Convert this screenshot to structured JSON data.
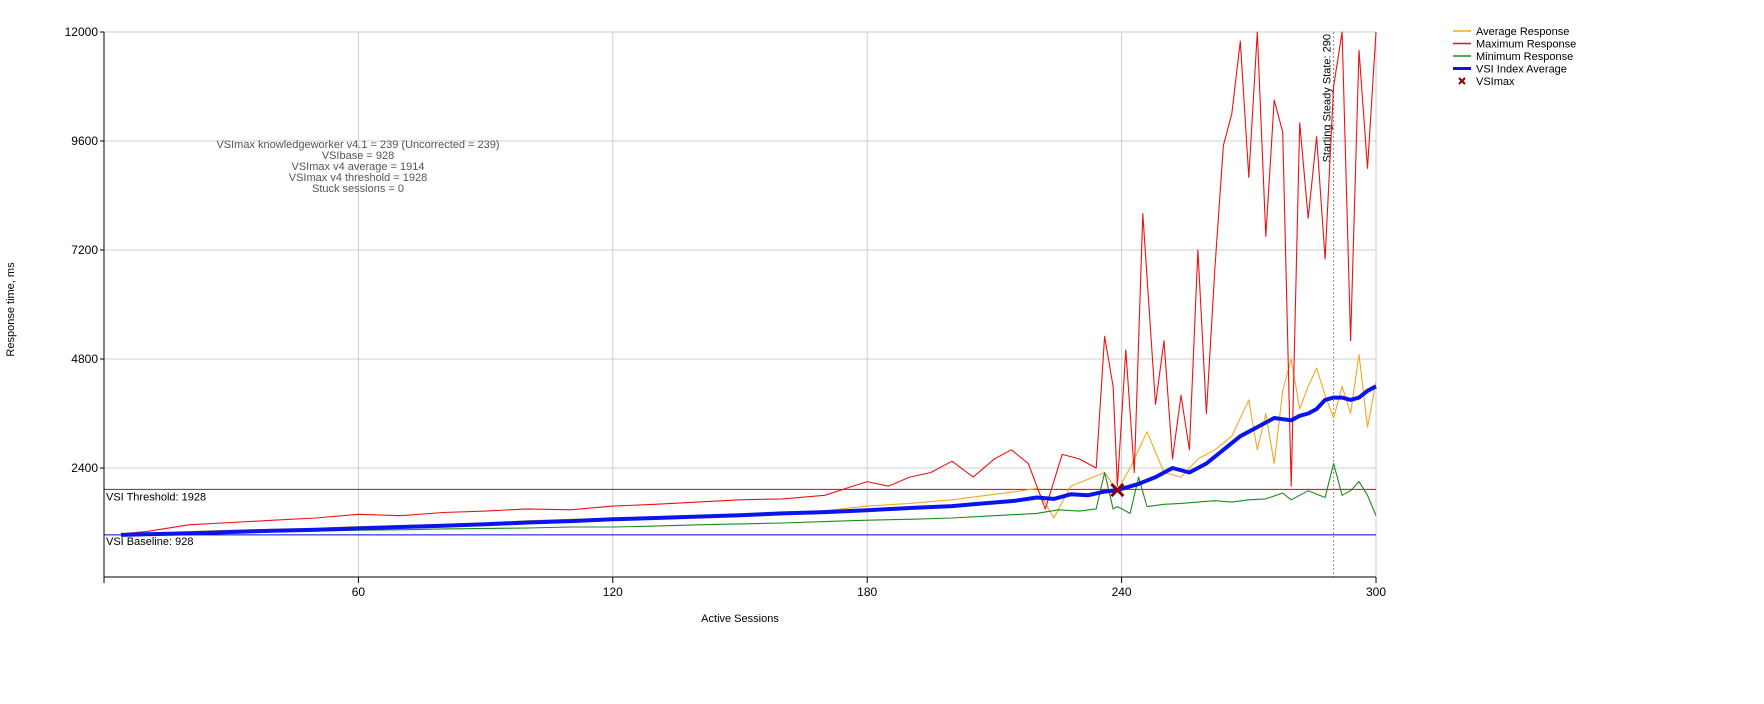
{
  "chart_data": {
    "type": "line",
    "xlabel": "Active Sessions",
    "ylabel": "Response time, ms",
    "xlim": [
      0,
      300
    ],
    "ylim": [
      0,
      12000
    ],
    "x_ticks": [
      60,
      120,
      180,
      240,
      300
    ],
    "y_ticks": [
      2400,
      4800,
      7200,
      9600,
      12000
    ],
    "grid": true,
    "legend_position": "top-right",
    "stats_lines": [
      "VSImax knowledgeworker v4.1 = 239 (Uncorrected = 239)",
      "VSIbase = 928",
      "VSImax v4 average = 1914",
      "VSImax v4 threshold = 1928",
      "Stuck sessions = 0"
    ],
    "reference_lines": [
      {
        "name": "threshold",
        "label": "VSI Threshold: 1928",
        "value": 1928,
        "color": "#e00000"
      },
      {
        "name": "baseline",
        "label": "VSI Baseline: 928",
        "value": 928,
        "color": "#0000dd"
      }
    ],
    "steady_state": {
      "label": "Starting Steady State: 290",
      "x": 290
    },
    "vsimax_marker": {
      "label": "VSImax",
      "x": 239,
      "y": 1914,
      "color": "#8b0000"
    },
    "series": [
      {
        "name": "Average Response",
        "color": "#f5a623",
        "x": [
          4,
          10,
          20,
          30,
          40,
          50,
          60,
          70,
          80,
          90,
          100,
          110,
          120,
          130,
          140,
          150,
          160,
          170,
          180,
          190,
          200,
          205,
          210,
          215,
          220,
          224,
          228,
          232,
          236,
          239,
          242,
          246,
          250,
          254,
          258,
          262,
          266,
          270,
          272,
          274,
          276,
          278,
          280,
          282,
          284,
          286,
          288,
          290,
          292,
          294,
          296,
          298,
          300
        ],
        "y": [
          930,
          960,
          1000,
          1030,
          1050,
          1070,
          1110,
          1130,
          1160,
          1190,
          1240,
          1270,
          1290,
          1310,
          1350,
          1380,
          1420,
          1460,
          1560,
          1620,
          1700,
          1760,
          1820,
          1880,
          1950,
          1300,
          2000,
          2150,
          2300,
          1900,
          2400,
          3200,
          2300,
          2200,
          2600,
          2800,
          3100,
          3900,
          2800,
          3600,
          2500,
          4100,
          4800,
          3700,
          4200,
          4600,
          4000,
          3500,
          4200,
          3600,
          4900,
          3300,
          4300
        ]
      },
      {
        "name": "Maximum Response",
        "color": "#ee1111",
        "x": [
          4,
          10,
          20,
          30,
          40,
          50,
          60,
          70,
          80,
          90,
          100,
          110,
          120,
          130,
          140,
          150,
          160,
          170,
          175,
          180,
          185,
          190,
          195,
          200,
          205,
          210,
          214,
          218,
          222,
          226,
          230,
          234,
          236,
          238,
          239,
          241,
          243,
          245,
          248,
          250,
          252,
          254,
          256,
          258,
          260,
          262,
          264,
          266,
          268,
          270,
          272,
          274,
          276,
          278,
          280,
          282,
          284,
          286,
          288,
          290,
          292,
          294,
          296,
          298,
          300
        ],
        "y": [
          950,
          1000,
          1150,
          1200,
          1250,
          1300,
          1380,
          1350,
          1420,
          1450,
          1500,
          1480,
          1560,
          1600,
          1650,
          1700,
          1720,
          1800,
          1950,
          2100,
          2000,
          2200,
          2300,
          2550,
          2200,
          2600,
          2800,
          2500,
          1500,
          2700,
          2600,
          2400,
          5300,
          4200,
          2000,
          5000,
          2300,
          8000,
          3800,
          5200,
          2600,
          4000,
          2800,
          7200,
          3600,
          6800,
          9500,
          10200,
          11800,
          8800,
          12000,
          7500,
          10500,
          9800,
          2000,
          10000,
          7900,
          9700,
          7000,
          10800,
          12000,
          5200,
          11600,
          9000,
          12000
        ]
      },
      {
        "name": "Minimum Response",
        "color": "#1a8c1a",
        "x": [
          4,
          10,
          20,
          30,
          40,
          50,
          60,
          70,
          80,
          90,
          100,
          110,
          120,
          130,
          140,
          150,
          160,
          170,
          180,
          190,
          200,
          210,
          220,
          225,
          230,
          234,
          236,
          238,
          239,
          242,
          244,
          246,
          250,
          254,
          258,
          262,
          266,
          270,
          274,
          278,
          280,
          284,
          288,
          290,
          292,
          294,
          296,
          298,
          300
        ],
        "y": [
          900,
          920,
          950,
          970,
          1000,
          1010,
          1030,
          1040,
          1060,
          1070,
          1080,
          1100,
          1100,
          1120,
          1150,
          1170,
          1190,
          1220,
          1250,
          1270,
          1300,
          1350,
          1400,
          1480,
          1450,
          1500,
          2300,
          1500,
          1550,
          1400,
          2200,
          1550,
          1600,
          1620,
          1650,
          1680,
          1650,
          1700,
          1720,
          1850,
          1700,
          1900,
          1750,
          2500,
          1800,
          1900,
          2100,
          1800,
          1350
        ]
      },
      {
        "name": "VSI Index Average",
        "color": "#0a14ee",
        "x": [
          4,
          10,
          20,
          30,
          40,
          50,
          60,
          70,
          80,
          90,
          100,
          110,
          120,
          130,
          140,
          150,
          160,
          170,
          180,
          190,
          200,
          205,
          210,
          215,
          220,
          224,
          228,
          232,
          236,
          239,
          244,
          248,
          252,
          256,
          260,
          264,
          268,
          272,
          276,
          280,
          282,
          284,
          286,
          288,
          290,
          292,
          294,
          296,
          298,
          300
        ],
        "y": [
          928,
          940,
          960,
          990,
          1020,
          1040,
          1070,
          1100,
          1130,
          1160,
          1200,
          1230,
          1270,
          1300,
          1330,
          1360,
          1400,
          1430,
          1470,
          1520,
          1560,
          1600,
          1640,
          1680,
          1750,
          1720,
          1820,
          1800,
          1880,
          1914,
          2050,
          2200,
          2400,
          2300,
          2500,
          2800,
          3100,
          3300,
          3500,
          3450,
          3550,
          3600,
          3700,
          3900,
          3950,
          3950,
          3900,
          3950,
          4100,
          4200
        ]
      }
    ]
  }
}
